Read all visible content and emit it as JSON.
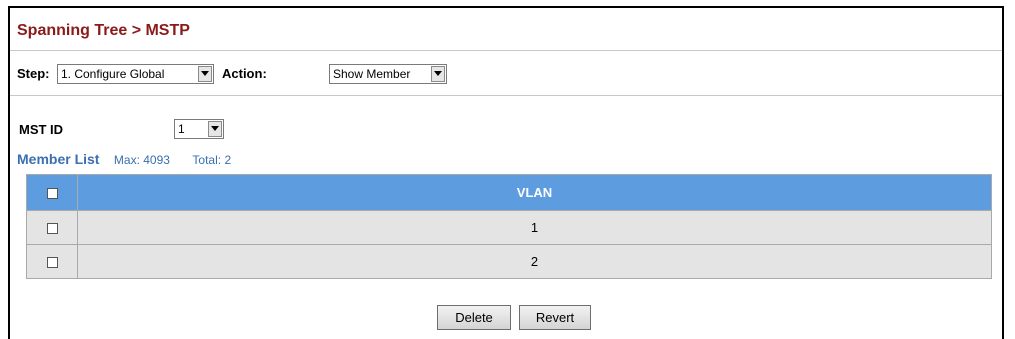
{
  "header": {
    "title": "Spanning Tree > MSTP"
  },
  "step": {
    "label": "Step:",
    "value": "1. Configure Global"
  },
  "action": {
    "label": "Action:",
    "value": "Show Member"
  },
  "mst": {
    "label": "MST ID",
    "value": "1"
  },
  "member_list": {
    "title": "Member List",
    "max": "Max: 4093",
    "total": "Total: 2",
    "column": "VLAN",
    "rows": [
      {
        "vlan": "1",
        "checked": false
      },
      {
        "vlan": "2",
        "checked": false
      }
    ]
  },
  "buttons": {
    "delete": "Delete",
    "revert": "Revert"
  },
  "colors": {
    "title": "#8b1a1a",
    "accent": "#3a6fb0",
    "table_header": "#5e9ce0",
    "row": "#e4e4e4"
  }
}
